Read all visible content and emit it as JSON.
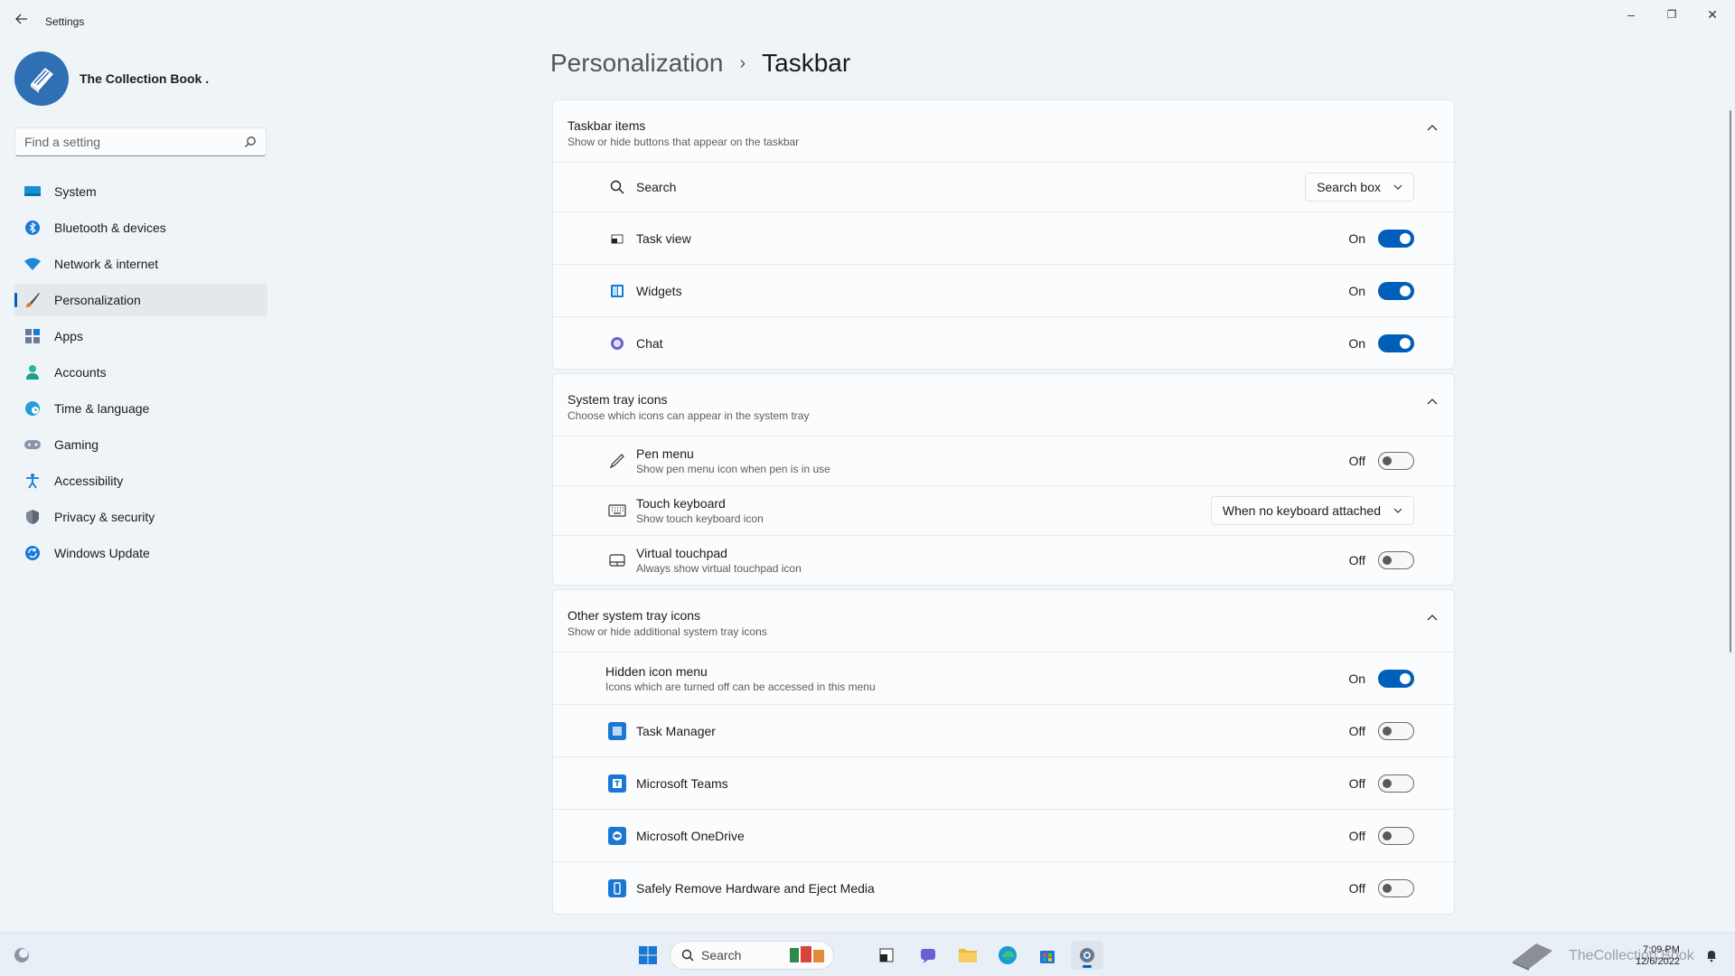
{
  "window": {
    "title": "Settings",
    "back_icon": "arrow-left-icon",
    "minimize": "–",
    "restore": "❐",
    "close": "✕"
  },
  "profile": {
    "name": "The Collection Book ."
  },
  "search": {
    "placeholder": "Find a setting"
  },
  "nav": [
    {
      "label": "System",
      "icon": "monitor-icon"
    },
    {
      "label": "Bluetooth & devices",
      "icon": "bluetooth-icon"
    },
    {
      "label": "Network & internet",
      "icon": "wifi-icon"
    },
    {
      "label": "Personalization",
      "icon": "brush-icon",
      "active": true
    },
    {
      "label": "Apps",
      "icon": "apps-icon"
    },
    {
      "label": "Accounts",
      "icon": "person-icon"
    },
    {
      "label": "Time & language",
      "icon": "globe-clock-icon"
    },
    {
      "label": "Gaming",
      "icon": "gamepad-icon"
    },
    {
      "label": "Accessibility",
      "icon": "accessibility-icon"
    },
    {
      "label": "Privacy & security",
      "icon": "shield-icon"
    },
    {
      "label": "Windows Update",
      "icon": "update-icon"
    }
  ],
  "breadcrumb": {
    "parent": "Personalization",
    "separator": "›",
    "current": "Taskbar"
  },
  "sections": {
    "taskbar_items": {
      "title": "Taskbar items",
      "subtitle": "Show or hide buttons that appear on the taskbar",
      "rows": {
        "search": {
          "label": "Search",
          "value": "Search box"
        },
        "task_view": {
          "label": "Task view",
          "state": "On"
        },
        "widgets": {
          "label": "Widgets",
          "state": "On"
        },
        "chat": {
          "label": "Chat",
          "state": "On"
        }
      }
    },
    "system_tray": {
      "title": "System tray icons",
      "subtitle": "Choose which icons can appear in the system tray",
      "rows": {
        "pen_menu": {
          "label": "Pen menu",
          "sub": "Show pen menu icon when pen is in use",
          "state": "Off"
        },
        "touch_keyboard": {
          "label": "Touch keyboard",
          "sub": "Show touch keyboard icon",
          "value": "When no keyboard attached"
        },
        "virtual_touchpad": {
          "label": "Virtual touchpad",
          "sub": "Always show virtual touchpad icon",
          "state": "Off"
        }
      }
    },
    "other_tray": {
      "title": "Other system tray icons",
      "subtitle": "Show or hide additional system tray icons",
      "rows": {
        "hidden_menu": {
          "label": "Hidden icon menu",
          "sub": "Icons which are turned off can be accessed in this menu",
          "state": "On"
        },
        "task_manager": {
          "label": "Task Manager",
          "state": "Off"
        },
        "teams": {
          "label": "Microsoft Teams",
          "state": "Off"
        },
        "onedrive": {
          "label": "Microsoft OneDrive",
          "state": "Off"
        },
        "safely_remove": {
          "label": "Safely Remove Hardware and Eject Media",
          "state": "Off"
        }
      }
    }
  },
  "taskbar": {
    "search_label": "Search",
    "time": "7:09 PM",
    "date": "12/6/2022",
    "watermark": "TheCollection Book"
  },
  "colors": {
    "accent": "#005fb8",
    "background": "#eff4f9",
    "card": "#fbfcfd"
  }
}
